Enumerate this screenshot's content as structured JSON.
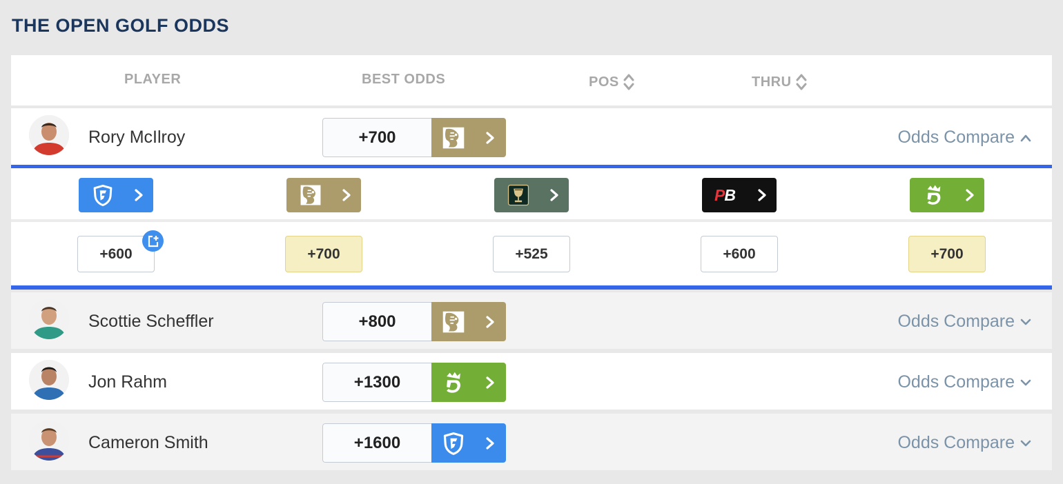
{
  "page": {
    "title": "THE OPEN GOLF ODDS"
  },
  "header": {
    "player": "PLAYER",
    "best_odds": "BEST ODDS",
    "pos": "POS",
    "thru": "THRU"
  },
  "colors": {
    "bet_mgm": "#ac9c6c",
    "draftkings": "#73ae36",
    "fanduel": "#3a8bec",
    "caesars": "#5a7262",
    "pointsbet": "#111111",
    "accent_blue": "#3565e8"
  },
  "players": [
    {
      "name": "Rory McIlroy",
      "best_odds": "+700",
      "book": "betmgm",
      "compare_label": "Odds Compare",
      "expanded": true
    },
    {
      "name": "Scottie Scheffler",
      "best_odds": "+800",
      "book": "betmgm",
      "compare_label": "Odds Compare",
      "expanded": false
    },
    {
      "name": "Jon Rahm",
      "best_odds": "+1300",
      "book": "draftkings",
      "compare_label": "Odds Compare",
      "expanded": false
    },
    {
      "name": "Cameron Smith",
      "best_odds": "+1600",
      "book": "fanduel",
      "compare_label": "Odds Compare",
      "expanded": false
    }
  ],
  "compare": {
    "books": [
      {
        "name": "fanduel",
        "icon": "fanduel-shield-icon",
        "odds": "+600",
        "best": false
      },
      {
        "name": "betmgm",
        "icon": "betmgm-lion-icon",
        "odds": "+700",
        "best": true
      },
      {
        "name": "caesars",
        "icon": "caesars-goblet-icon",
        "odds": "+525",
        "best": false
      },
      {
        "name": "pointsbet",
        "icon": "pointsbet-logo",
        "odds": "+600",
        "best": false
      },
      {
        "name": "draftkings",
        "icon": "draftkings-crown-icon",
        "odds": "+700",
        "best": true
      }
    ],
    "pointsbet_text": "PB"
  }
}
